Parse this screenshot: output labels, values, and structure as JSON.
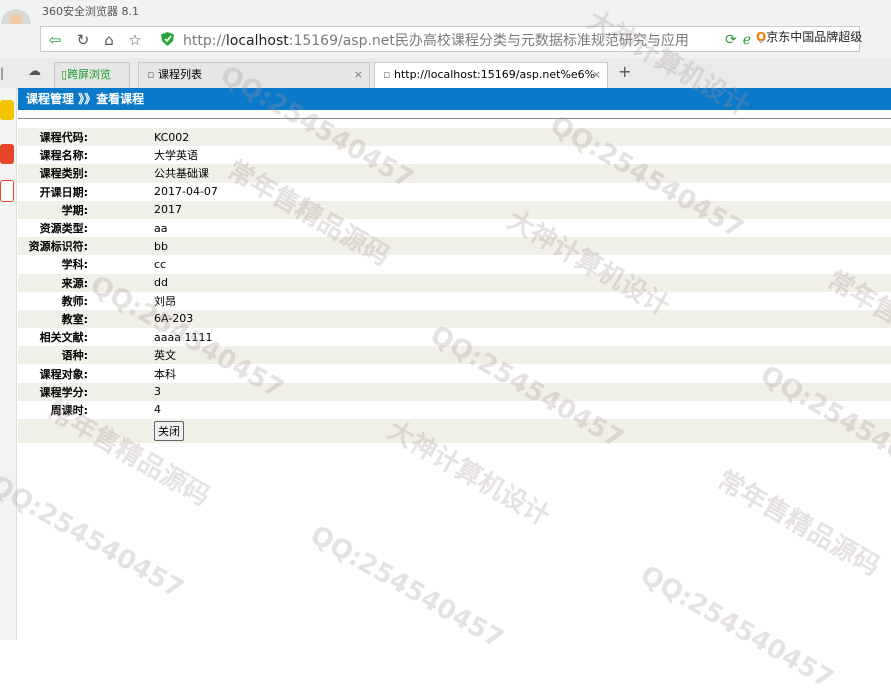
{
  "browser": {
    "app_title": "360安全浏览器 8.1",
    "url_scheme": "http://",
    "url_host": "localhost",
    "url_rest": ":15169/asp.net民办高校课程分类与元数据标准规范研究与应用",
    "right_link": "京东中国品牌超级",
    "tabs": [
      {
        "label": "跨屏浏览"
      },
      {
        "label": "课程列表"
      },
      {
        "label": "http://localhost:15169/asp.net%e6%"
      }
    ]
  },
  "page": {
    "header": "课程管理 》》查看课程",
    "fields": [
      {
        "label": "课程代码:",
        "value": "KC002"
      },
      {
        "label": "课程名称:",
        "value": "大学英语"
      },
      {
        "label": "课程类别:",
        "value": "公共基础课"
      },
      {
        "label": "开课日期:",
        "value": "2017-04-07"
      },
      {
        "label": "学期:",
        "value": "2017"
      },
      {
        "label": "资源类型:",
        "value": "aa"
      },
      {
        "label": "资源标识符:",
        "value": "bb"
      },
      {
        "label": "学科:",
        "value": "cc"
      },
      {
        "label": "来源:",
        "value": "dd"
      },
      {
        "label": "教师:",
        "value": "刘昂"
      },
      {
        "label": "教室:",
        "value": "6A-203"
      },
      {
        "label": "相关文献:",
        "value": "aaaa 1111"
      },
      {
        "label": "语种:",
        "value": "英文"
      },
      {
        "label": "课程对象:",
        "value": "本科"
      },
      {
        "label": "课程学分:",
        "value": "3"
      },
      {
        "label": "周课时:",
        "value": "4"
      }
    ],
    "close_label": "关闭"
  },
  "watermarks": [
    "QQ:254540457",
    "大神计算机设计",
    "常年售精品源码"
  ],
  "colors": {
    "header_bg": "#0a79c9",
    "row_bg": "#f0efe8"
  }
}
